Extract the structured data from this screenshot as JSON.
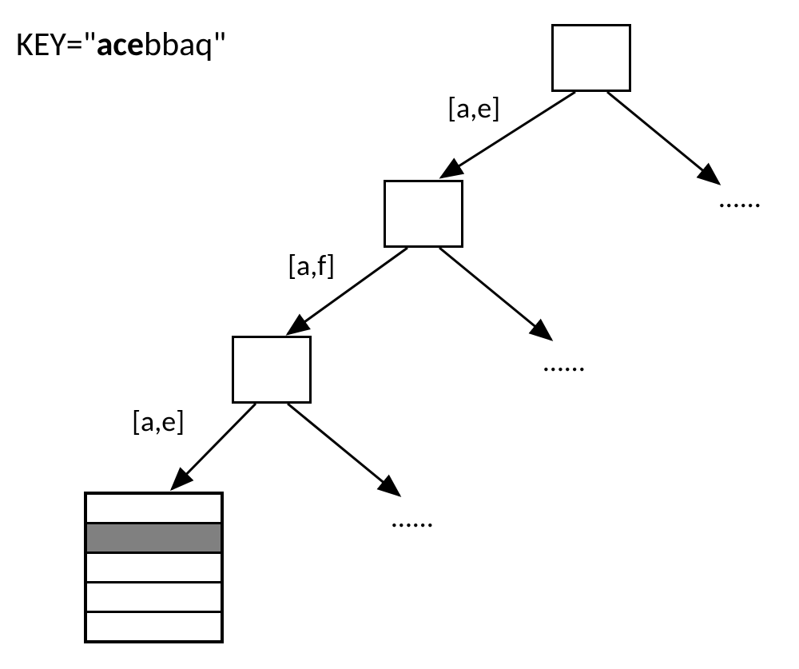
{
  "key_label": {
    "prefix": "KEY=",
    "quote_open": "\"",
    "bold_part": "ace",
    "rest_part": "bbaq",
    "quote_close": "\""
  },
  "edges": {
    "e1": "[a,e]",
    "e2": "[a,f]",
    "e3": "[a,e]"
  },
  "dots": "……",
  "chart_data": {
    "type": "tree",
    "title": "KEY=\"acebbaq\"",
    "description": "Prefix tree / trie traversal for key 'acebbaq'. Bold prefix 'ace' is matched edge by edge; remaining 'bbaq' lands in a leaf page where one row (index 1) is hit.",
    "nodes": [
      {
        "id": "n0",
        "type": "internal",
        "level": 0
      },
      {
        "id": "n1",
        "type": "internal",
        "level": 1
      },
      {
        "id": "n2",
        "type": "internal",
        "level": 2
      },
      {
        "id": "leaf",
        "type": "leaf",
        "level": 3,
        "rows": 5,
        "highlighted_row_index": 1
      }
    ],
    "edges": [
      {
        "from": "n0",
        "to": "n1",
        "label": "[a,e]",
        "range": [
          "a",
          "e"
        ]
      },
      {
        "from": "n0",
        "to": "dots0",
        "label": null
      },
      {
        "from": "n1",
        "to": "n2",
        "label": "[a,f]",
        "range": [
          "a",
          "f"
        ]
      },
      {
        "from": "n1",
        "to": "dots1",
        "label": null
      },
      {
        "from": "n2",
        "to": "leaf",
        "label": "[a,e]",
        "range": [
          "a",
          "e"
        ]
      },
      {
        "from": "n2",
        "to": "dots2",
        "label": null
      }
    ]
  }
}
